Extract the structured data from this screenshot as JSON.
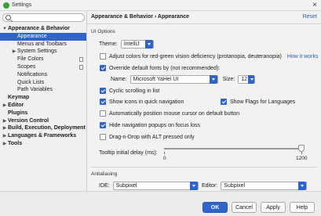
{
  "window": {
    "title": "Settings",
    "close": "×"
  },
  "search": {
    "placeholder": ""
  },
  "sidebar": {
    "items": [
      {
        "label": "Appearance & Behavior",
        "level": 0,
        "arrow": "▼",
        "bold": true
      },
      {
        "label": "Appearance",
        "level": 1,
        "selected": true
      },
      {
        "label": "Menus and Toolbars",
        "level": 1
      },
      {
        "label": "System Settings",
        "level": 1,
        "arrow": "▶"
      },
      {
        "label": "File Colors",
        "level": 1,
        "copy": true
      },
      {
        "label": "Scopes",
        "level": 1,
        "copy": true
      },
      {
        "label": "Notifications",
        "level": 1
      },
      {
        "label": "Quick Lists",
        "level": 1
      },
      {
        "label": "Path Variables",
        "level": 1
      },
      {
        "label": "Keymap",
        "level": 0,
        "bold": true
      },
      {
        "label": "Editor",
        "level": 0,
        "arrow": "▶",
        "bold": true
      },
      {
        "label": "Plugins",
        "level": 0,
        "bold": true
      },
      {
        "label": "Version Control",
        "level": 0,
        "arrow": "▶",
        "bold": true
      },
      {
        "label": "Build, Execution, Deployment",
        "level": 0,
        "arrow": "▶",
        "bold": true
      },
      {
        "label": "Languages & Frameworks",
        "level": 0,
        "arrow": "▶",
        "bold": true
      },
      {
        "label": "Tools",
        "level": 0,
        "arrow": "▶",
        "bold": true
      }
    ]
  },
  "header": {
    "breadcrumb": "Appearance & Behavior › Appearance",
    "reset": "Reset"
  },
  "ui_options": {
    "section": "UI Options",
    "theme_label": "Theme:",
    "theme_value": "IntelliJ",
    "adjust_colors": {
      "label": "Adjust colors for red-green vision deficiency (protanopia, deuteranopia)",
      "checked": false,
      "link": "How it works"
    },
    "override_fonts": {
      "label": "Override default fonts by (not recommended):",
      "checked": true
    },
    "font_name_label": "Name:",
    "font_name_value": "Microsoft YaHei UI",
    "font_size_label": "Size:",
    "font_size_value": "12",
    "cyclic_scrolling": {
      "label": "Cyclic scrolling in list",
      "checked": true
    },
    "show_icons": {
      "label": "Show icons in quick navigation",
      "checked": true
    },
    "show_flags": {
      "label": "Show Flags for Languages",
      "checked": true
    },
    "auto_mouse": {
      "label": "Automatically position mouse cursor on default button",
      "checked": false
    },
    "hide_popups": {
      "label": "Hide navigation popups on focus loss",
      "checked": true
    },
    "drag_n_drop": {
      "label": "Drag-n-Drop with ALT pressed only",
      "checked": false
    },
    "tooltip_label": "Tooltip initial delay (ms):",
    "tooltip_min": "0",
    "tooltip_max": "1200",
    "tooltip_value_fraction": 1.0
  },
  "antialiasing": {
    "section": "Antialiasing",
    "ide_label": "IDE:",
    "ide_value": "Subpixel",
    "editor_label": "Editor:",
    "editor_value": "Subpixel"
  },
  "buttons": {
    "ok": "OK",
    "cancel": "Cancel",
    "apply": "Apply",
    "help": "Help"
  },
  "colors": {
    "accent": "#2f65ca",
    "link": "#2a5db0"
  }
}
